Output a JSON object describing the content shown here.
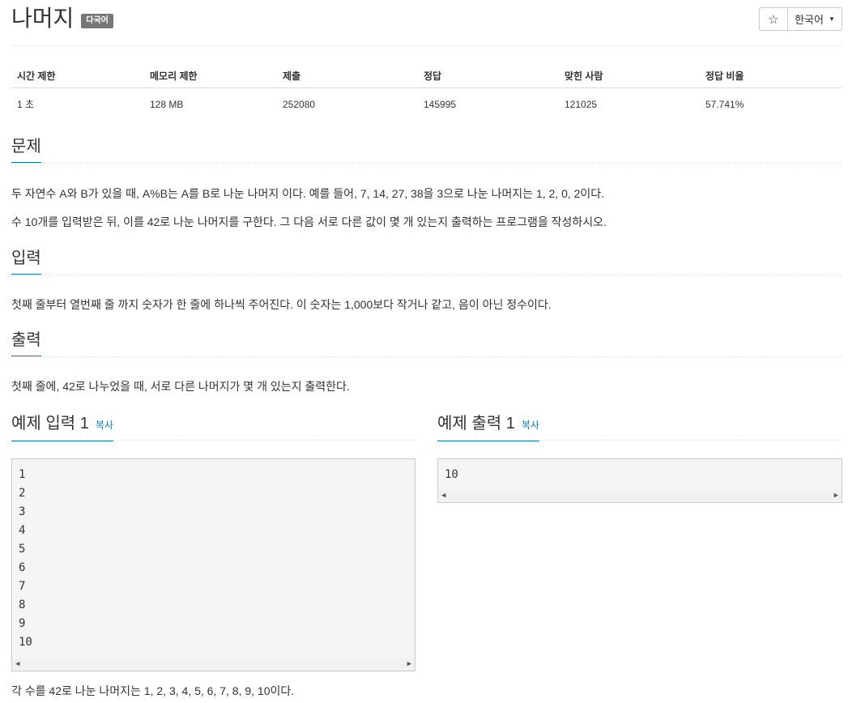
{
  "header": {
    "title": "나머지",
    "badge": "다국어",
    "star": "☆",
    "language": "한국어"
  },
  "info_table": {
    "headers": [
      "시간 제한",
      "메모리 제한",
      "제출",
      "정답",
      "맞힌 사람",
      "정답 비율"
    ],
    "values": [
      "1 초",
      "128 MB",
      "252080",
      "145995",
      "121025",
      "57.741%"
    ]
  },
  "problem": {
    "heading": "문제",
    "lines": [
      "두 자연수 A와 B가 있을 때, A%B는 A를 B로 나눈 나머지 이다. 예를 들어, 7, 14, 27, 38을 3으로 나눈 나머지는 1, 2, 0, 2이다.",
      "수 10개를 입력받은 뒤, 이를 42로 나눈 나머지를 구한다. 그 다음 서로 다른 값이 몇 개 있는지 출력하는 프로그램을 작성하시오."
    ]
  },
  "input": {
    "heading": "입력",
    "text": "첫째 줄부터 열번째 줄 까지 숫자가 한 줄에 하나씩 주어진다. 이 숫자는 1,000보다 작거나 같고, 음이 아닌 정수이다."
  },
  "output": {
    "heading": "출력",
    "text": "첫째 줄에, 42로 나누었을 때, 서로 다른 나머지가 몇 개 있는지 출력한다."
  },
  "sample_input": {
    "heading": "예제 입력 1",
    "copy": "복사",
    "lines": [
      "1",
      "2",
      "3",
      "4",
      "5",
      "6",
      "7",
      "8",
      "9",
      "10"
    ]
  },
  "sample_output": {
    "heading": "예제 출력 1",
    "copy": "복사",
    "lines": [
      "10"
    ]
  },
  "hint": {
    "text": "각 수를 42로 나눈 나머지는 1, 2, 3, 4, 5, 6, 7, 8, 9, 10이다."
  },
  "colors": {
    "accent": "#0e7fa3",
    "badge": "#777777"
  }
}
